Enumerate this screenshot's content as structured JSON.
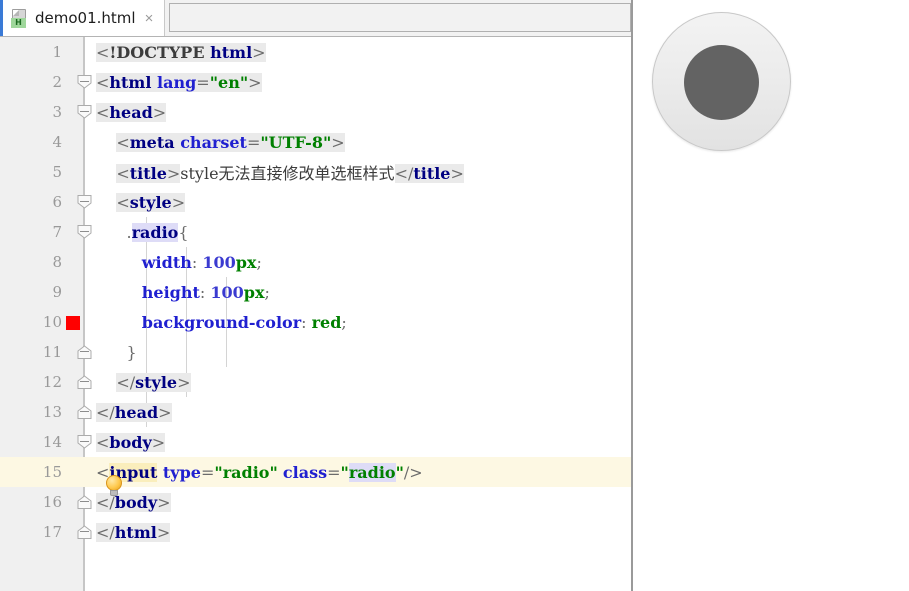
{
  "window": {
    "app": "code-editor",
    "accent_color": "#3a7ad6"
  },
  "tabbar": {
    "tabs": [
      {
        "label": "demo01.html",
        "icon": "html-file-icon",
        "badge": "H",
        "close": "×",
        "active": true
      }
    ]
  },
  "editor": {
    "current_line": 15,
    "gutter": {
      "color_swatch_line": 10,
      "color_swatch_value": "#ff0000"
    },
    "intention_bulb": {
      "icon": "lightbulb-icon",
      "line": 14
    },
    "lines": [
      {
        "n": "1",
        "indent": 0,
        "fold": "",
        "text": "<!DOCTYPE html>"
      },
      {
        "n": "2",
        "indent": 0,
        "fold": "open",
        "text": "<html lang=\"en\">"
      },
      {
        "n": "3",
        "indent": 0,
        "fold": "open",
        "text": "<head>"
      },
      {
        "n": "4",
        "indent": 1,
        "fold": "",
        "text": "<meta charset=\"UTF-8\">"
      },
      {
        "n": "5",
        "indent": 1,
        "fold": "",
        "text": "<title>style无法直接修改单选框样式</title>"
      },
      {
        "n": "6",
        "indent": 1,
        "fold": "open",
        "text": "<style>"
      },
      {
        "n": "7",
        "indent": 2,
        "fold": "open",
        "text": ".radio{"
      },
      {
        "n": "8",
        "indent": 3,
        "fold": "",
        "text": "width: 100px;"
      },
      {
        "n": "9",
        "indent": 3,
        "fold": "",
        "text": "height: 100px;"
      },
      {
        "n": "10",
        "indent": 3,
        "fold": "",
        "text": "background-color: red;"
      },
      {
        "n": "11",
        "indent": 2,
        "fold": "close",
        "text": "}"
      },
      {
        "n": "12",
        "indent": 1,
        "fold": "close",
        "text": "</style>"
      },
      {
        "n": "13",
        "indent": 0,
        "fold": "close",
        "text": "</head>"
      },
      {
        "n": "14",
        "indent": 0,
        "fold": "open",
        "text": "<body>"
      },
      {
        "n": "15",
        "indent": 0,
        "fold": "",
        "text": "<input type=\"radio\" class=\"radio\"/>"
      },
      {
        "n": "16",
        "indent": 0,
        "fold": "close",
        "text": "</body>"
      },
      {
        "n": "17",
        "indent": 0,
        "fold": "close",
        "text": "</html>"
      }
    ],
    "syntax_colors": {
      "tag": "#000082",
      "attribute": "#2020d0",
      "string": "#008000",
      "number": "#3a3ad0",
      "punctuation": "#6b6b6b",
      "text": "#3c3c3c",
      "current_line_bg": "#fdf8e3",
      "identifier_highlight_bg": "#dedcf7",
      "tag_match_bg": "#eaeaea"
    }
  },
  "preview": {
    "element": "radio-input-preview",
    "outer_color": "#ececec",
    "dot_color": "#636363",
    "size_px": "100px"
  }
}
